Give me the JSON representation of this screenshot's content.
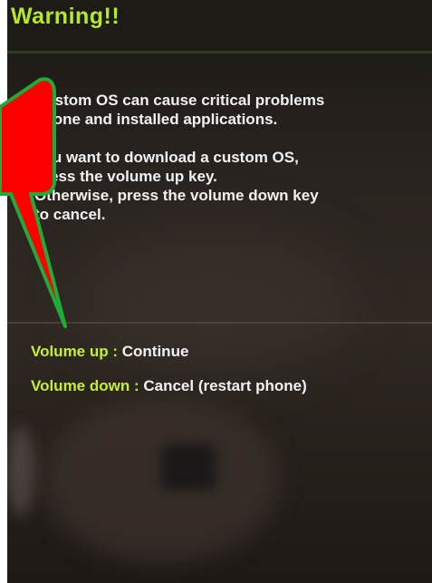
{
  "warning": {
    "title": "Warning!!",
    "message": "Custom OS can cause critical problems\nphone and installed applications.\n\nyou want to download a custom OS,\npress the volume up key.\nOtherwise, press the volume down key\nto cancel."
  },
  "options": [
    {
      "key": "Volume up : ",
      "action": "Continue"
    },
    {
      "key": "Volume down : ",
      "action": "Cancel (restart phone)"
    }
  ],
  "colors": {
    "title_green": "#b8e62a",
    "option_green": "#c5ef2e",
    "callout_red": "#ff0000",
    "callout_border": "#1faa3a"
  },
  "icons": {
    "callout": "speech-bubble-arrow"
  }
}
